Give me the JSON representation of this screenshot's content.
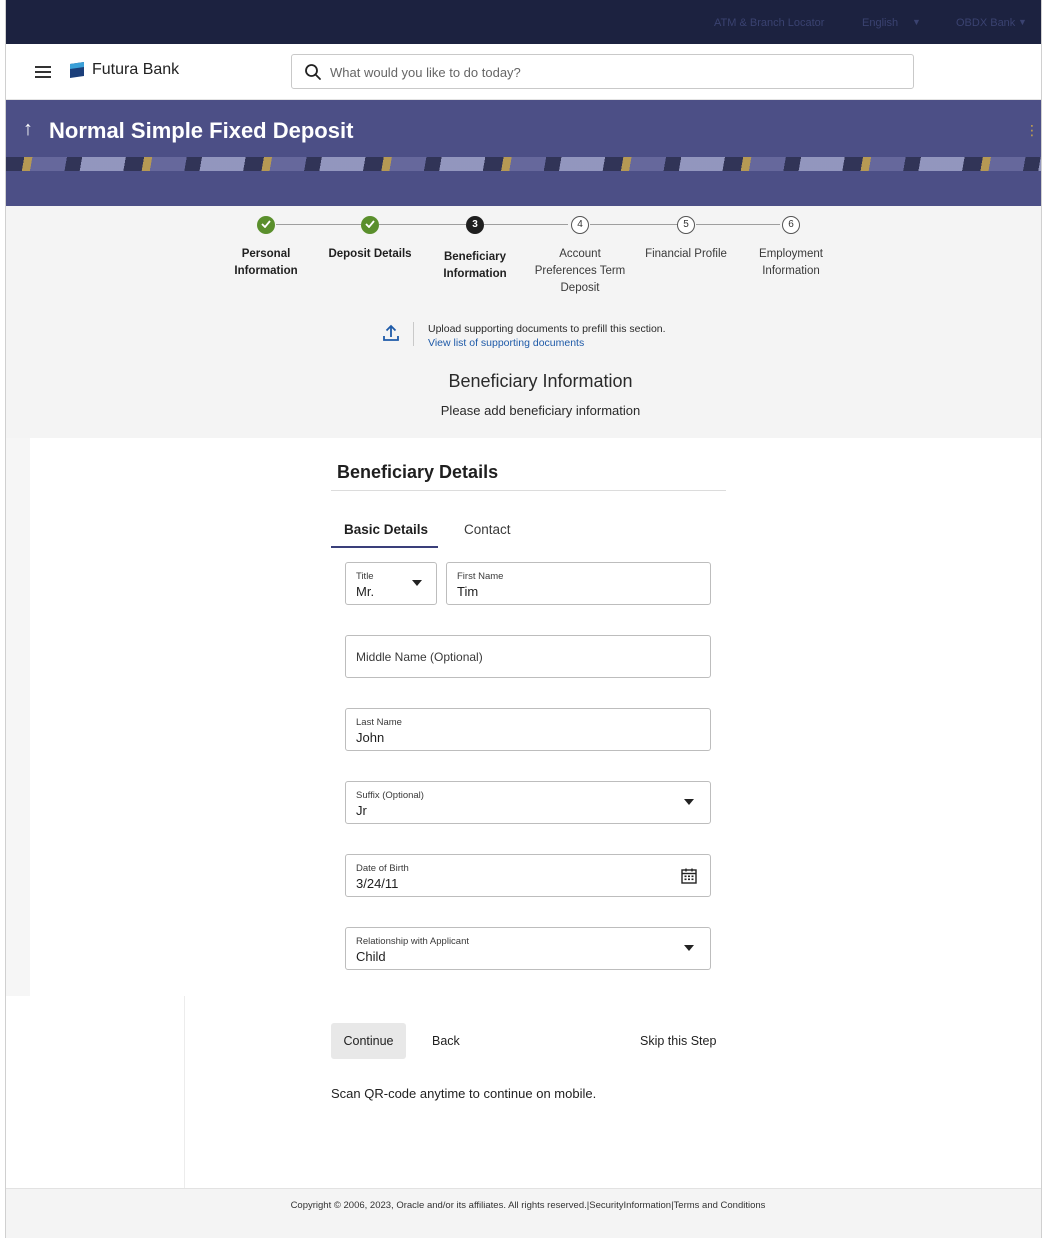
{
  "topbar": {
    "branch": "ATM & Branch Locator",
    "language": "English",
    "user": "OBDX Bank"
  },
  "header": {
    "brand": "Futura Bank",
    "search_placeholder": "What would you like to do today?"
  },
  "banner": {
    "title": "Normal Simple Fixed Deposit"
  },
  "stepper": {
    "steps": [
      {
        "number": "1",
        "label_line1": "Personal",
        "label_line2": "Information",
        "status": "completed"
      },
      {
        "number": "2",
        "label_line1": "Deposit Details",
        "label_line2": "",
        "status": "completed"
      },
      {
        "number": "3",
        "label_line1": "Beneficiary",
        "label_line2": "Information",
        "status": "active"
      },
      {
        "number": "4",
        "label_line1": "Account",
        "label_line2": "Preferences Term",
        "label_line3": "Deposit",
        "status": "pending"
      },
      {
        "number": "5",
        "label_line1": "Financial Profile",
        "label_line2": "",
        "status": "pending"
      },
      {
        "number": "6",
        "label_line1": "Employment",
        "label_line2": "Information",
        "status": "pending"
      }
    ]
  },
  "upload": {
    "text": "Upload supporting documents to prefill this section.",
    "link": "View list of supporting documents"
  },
  "section": {
    "title": "Beneficiary Information",
    "subtitle": "Please add  beneficiary information"
  },
  "form": {
    "card_title": "Beneficiary Details",
    "tabs": [
      "Basic Details",
      "Contact"
    ],
    "title_label": "Title",
    "title_value": "Mr.",
    "first_name_label": "First Name",
    "first_name_value": "Tim",
    "middle_name_placeholder": "Middle Name (Optional)",
    "last_name_label": "Last Name",
    "last_name_value": "John",
    "suffix_label": "Suffix (Optional)",
    "suffix_value": "Jr",
    "dob_label": "Date of Birth",
    "dob_value": "3/24/11",
    "relationship_label": "Relationship with Applicant",
    "relationship_value": "Child"
  },
  "actions": {
    "continue": "Continue",
    "back": "Back",
    "skip": "Skip this Step"
  },
  "qr_text": "Scan QR-code anytime to continue on mobile.",
  "footer": "Copyright © 2006, 2023, Oracle and/or its affiliates. All rights reserved.|SecurityInformation|Terms and Conditions",
  "colors": {
    "topbar": "#1c2240",
    "banner": "#4c4f86",
    "completed_step": "#5a8f2c",
    "accent": "#3a3f7a",
    "link": "#1e5aa8"
  }
}
